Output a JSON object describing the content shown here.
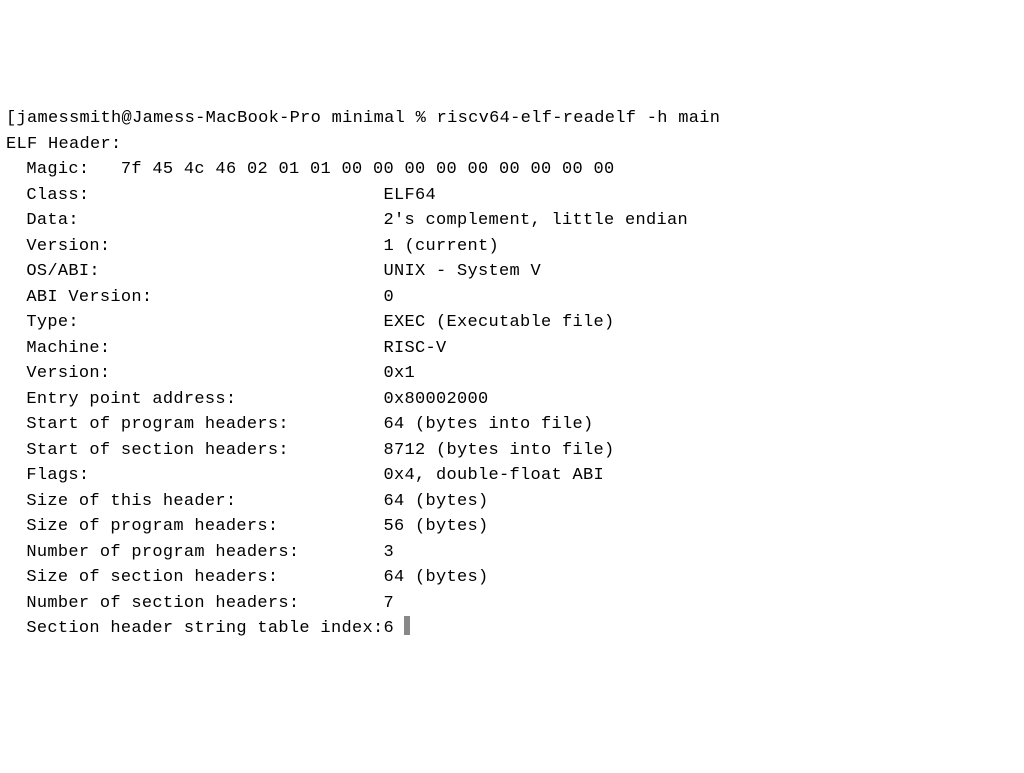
{
  "prompt": {
    "user": "jamessmith",
    "host": "Jamess-MacBook-Pro",
    "directory": "minimal",
    "symbol": "%",
    "command": "riscv64-elf-readelf -h main"
  },
  "output": {
    "header": "ELF Header:",
    "magic": {
      "label": "Magic:",
      "value": "7f 45 4c 46 02 01 01 00 00 00 00 00 00 00 00 00"
    },
    "fields": [
      {
        "label": "Class:",
        "value": "ELF64"
      },
      {
        "label": "Data:",
        "value": "2's complement, little endian"
      },
      {
        "label": "Version:",
        "value": "1 (current)"
      },
      {
        "label": "OS/ABI:",
        "value": "UNIX - System V"
      },
      {
        "label": "ABI Version:",
        "value": "0"
      },
      {
        "label": "Type:",
        "value": "EXEC (Executable file)"
      },
      {
        "label": "Machine:",
        "value": "RISC-V"
      },
      {
        "label": "Version:",
        "value": "0x1"
      },
      {
        "label": "Entry point address:",
        "value": "0x80002000"
      },
      {
        "label": "Start of program headers:",
        "value": "64 (bytes into file)"
      },
      {
        "label": "Start of section headers:",
        "value": "8712 (bytes into file)"
      },
      {
        "label": "Flags:",
        "value": "0x4, double-float ABI"
      },
      {
        "label": "Size of this header:",
        "value": "64 (bytes)"
      },
      {
        "label": "Size of program headers:",
        "value": "56 (bytes)"
      },
      {
        "label": "Number of program headers:",
        "value": "3"
      },
      {
        "label": "Size of section headers:",
        "value": "64 (bytes)"
      },
      {
        "label": "Number of section headers:",
        "value": "7"
      },
      {
        "label": "Section header string table index:",
        "value": "6"
      }
    ]
  }
}
